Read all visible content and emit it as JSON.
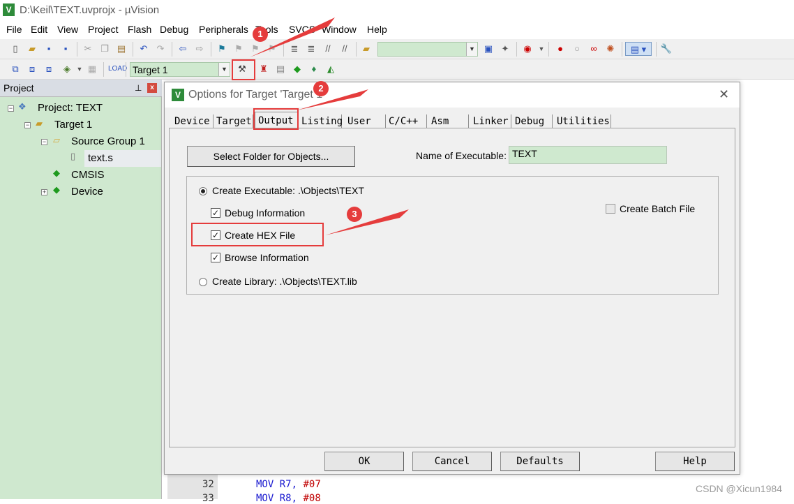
{
  "window": {
    "title": "D:\\Keil\\TEXT.uvprojx - µVision",
    "app_logo": "V"
  },
  "menu": [
    "File",
    "Edit",
    "View",
    "Project",
    "Flash",
    "Debug",
    "Peripherals",
    "Tools",
    "SVCS",
    "Window",
    "Help"
  ],
  "toolbar1": {
    "icons": [
      "new-file-icon",
      "open-icon",
      "save-icon",
      "save-all-icon",
      "cut-icon",
      "copy-icon",
      "paste-icon",
      "undo-icon",
      "redo-icon",
      "nav-back-icon",
      "nav-forward-icon",
      "bookmark-icon",
      "bookmark-prev-icon",
      "bookmark-next-icon",
      "bookmark-clear-icon",
      "indent-icon",
      "unindent-icon",
      "comment-icon",
      "uncomment-icon",
      "open-folder-icon",
      "find-in-files-icon",
      "debug-start-icon",
      "breakpoint-icon",
      "breakpoint-disable-icon",
      "breakpoint-kill-icon",
      "view-windows-icon",
      "configure-icon"
    ]
  },
  "toolbar2": {
    "target_select": "Target 1",
    "icons": [
      "translate-icon",
      "build-icon",
      "rebuild-icon",
      "download-icon",
      "batch-build-icon",
      "target-options-icon",
      "manage-components-icon",
      "select-packs-icon",
      "pack-installer-icon",
      "run-icon"
    ]
  },
  "project_panel": {
    "title": "Project",
    "tree": {
      "project": "Project: TEXT",
      "target": "Target 1",
      "group": "Source Group 1",
      "file": "text.s",
      "cmsis": "CMSIS",
      "device": "Device"
    }
  },
  "editor": {
    "lines": [
      {
        "num": "32",
        "op": "MOV",
        "reg": "R7,",
        "val": "#07"
      },
      {
        "num": "33",
        "op": "MOV",
        "reg": "R8,",
        "val": "#08"
      }
    ]
  },
  "dialog": {
    "title": "Options for Target 'Target 1'",
    "logo": "V",
    "close": "✕",
    "tabs": [
      "Device",
      "Target",
      "Output",
      "Listing",
      "User",
      "C/C++",
      "Asm",
      "Linker",
      "Debug",
      "Utilities"
    ],
    "active_tab": "Output",
    "select_folder_button": "Select Folder for Objects...",
    "exe_name_label": "Name of Executable:",
    "exe_name_value": "TEXT",
    "create_executable_label": "Create Executable:  .\\Objects\\TEXT",
    "create_executable_selected": true,
    "debug_info_label": "Debug Information",
    "debug_info_checked": true,
    "create_hex_label": "Create HEX File",
    "create_hex_checked": true,
    "browse_info_label": "Browse Information",
    "browse_info_checked": true,
    "create_library_label": "Create Library:  .\\Objects\\TEXT.lib",
    "create_library_selected": false,
    "create_batch_label": "Create Batch File",
    "create_batch_checked": false,
    "buttons": {
      "ok": "OK",
      "cancel": "Cancel",
      "defaults": "Defaults",
      "help": "Help"
    }
  },
  "annotations": {
    "badges": [
      "1",
      "2",
      "3"
    ],
    "color": "#e53c3c"
  },
  "watermark": "CSDN @Xicun1984"
}
